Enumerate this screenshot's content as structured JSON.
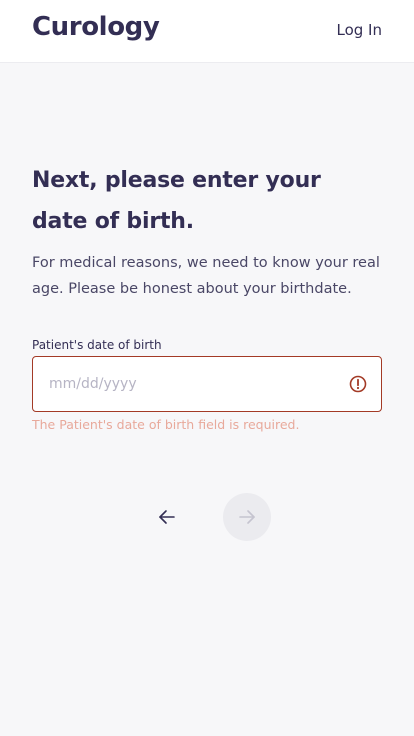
{
  "header": {
    "logo_text": "Curology",
    "login_label": "Log In"
  },
  "main": {
    "title": "Next, please enter your date of birth.",
    "description": "For medical reasons, we need to know your real age. Please be honest about your birthdate.",
    "field": {
      "label": "Patient's date of birth",
      "value": "",
      "placeholder": "mm/dd/yyyy",
      "error": "The Patient's date of birth field is required.",
      "status": "error"
    },
    "nav": {
      "back_icon": "arrow-left-icon",
      "next_icon": "arrow-right-icon",
      "next_enabled": false
    }
  },
  "colors": {
    "brand": "#332e54",
    "error_border": "#a33a26",
    "error_text": "#e8a99b",
    "background": "#f7f7f9",
    "disabled_button": "#ebebef"
  }
}
